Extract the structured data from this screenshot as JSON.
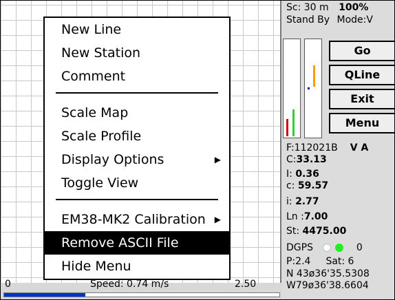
{
  "status": {
    "scale": "Sc:  30 m",
    "percent": "100%",
    "stand_by": "Stand By",
    "mode": "Mode:V"
  },
  "buttons": [
    "Go",
    "QLine",
    "Exit",
    "Menu"
  ],
  "menu": {
    "items": [
      {
        "label": "New Line"
      },
      {
        "label": "New Station"
      },
      {
        "label": "Comment"
      },
      {
        "label": "Scale Map"
      },
      {
        "label": "Scale Profile"
      },
      {
        "label": "Display Options",
        "submenu": true
      },
      {
        "label": "Toggle View"
      },
      {
        "label": "EM38-MK2 Calibration",
        "submenu": true
      },
      {
        "label": "Remove ASCII File",
        "selected": true
      },
      {
        "label": "Hide Menu"
      }
    ]
  },
  "readings": {
    "f_label": "F:112021B",
    "va": "V A",
    "c_upper_label": "C:",
    "c_upper_value": "33.13",
    "i_upper_label": "I:",
    "i_upper_value": "0.36",
    "c_lower_label": "c:",
    "c_lower_value": "59.57",
    "i_lower_label": "i:",
    "i_lower_value": "2.77",
    "ln_label": "Ln :",
    "ln_value": "7.00",
    "st_label": "St:",
    "st_value": "4475.00"
  },
  "gps": {
    "dgps_label": "DGPS",
    "dgps_count": "0",
    "p_value": "P:2.4",
    "sat_value": "Sat:  6",
    "north": "N 43ø36'35.5308",
    "west": "W79ø36'38.6604"
  },
  "speedbar": {
    "min": "0",
    "max": "2.50",
    "speed_text": "Speed: 0.74 m/s",
    "progress_fraction": 0.296
  },
  "gauge_bars": [
    {
      "color": "#cc0000",
      "level": 0.18
    },
    {
      "color": "#33cc33",
      "level": 0.28
    },
    {
      "color": "#ff9900",
      "level": 0.22
    },
    {
      "color": "#0000cc",
      "level": 0.02
    }
  ],
  "colors": {
    "menu_highlight": "#000000",
    "progress": "#0033cc",
    "dgps_white": "#ffffff",
    "dgps_green": "#22ee22"
  }
}
